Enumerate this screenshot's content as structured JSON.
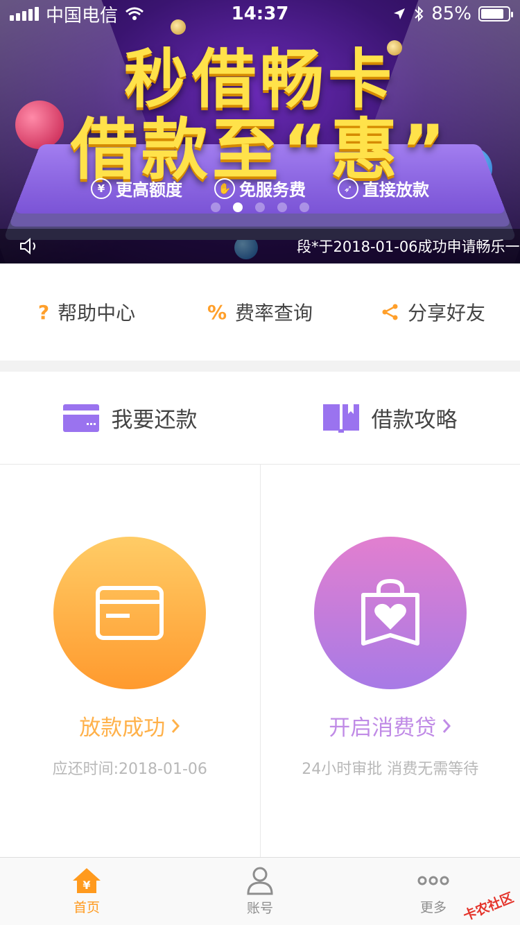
{
  "status_bar": {
    "carrier": "中国电信",
    "time": "14:37",
    "battery": "85%",
    "battery_level": 0.85
  },
  "banner": {
    "headline_1": "秒借畅卡",
    "headline_2": "借款至“惠”",
    "features": [
      {
        "label": "更高额度",
        "icon": "money-icon"
      },
      {
        "label": "免服务费",
        "icon": "hand-icon"
      },
      {
        "label": "直接放款",
        "icon": "rocket-icon"
      }
    ],
    "slide_count": 5,
    "active_slide": 2,
    "ticker": "段*于2018-01-06成功申请畅乐一"
  },
  "quick_links": [
    {
      "label": "帮助中心",
      "icon": "question-icon",
      "glyph": "?"
    },
    {
      "label": "费率查询",
      "icon": "percent-icon",
      "glyph": "%"
    },
    {
      "label": "分享好友",
      "icon": "share-icon",
      "glyph": ""
    }
  ],
  "actions": [
    {
      "label": "我要还款",
      "icon": "card-icon"
    },
    {
      "label": "借款攻略",
      "icon": "book-icon"
    }
  ],
  "cards": [
    {
      "title": "放款成功",
      "subtitle": "应还时间:2018-01-06",
      "icon": "card-icon",
      "color": "#ffb14a"
    },
    {
      "title": "开启消费贷",
      "subtitle": "24小时审批 消费无需等待",
      "icon": "shopping-bag-heart-icon",
      "color": "#c08be6"
    }
  ],
  "tabbar": {
    "tabs": [
      {
        "label": "首页",
        "icon": "home-icon",
        "active": true
      },
      {
        "label": "账号",
        "icon": "user-icon",
        "active": false
      },
      {
        "label": "更多",
        "icon": "more-icon",
        "active": false
      }
    ],
    "accent": "#ff9a1e"
  },
  "watermark": "卡农社区"
}
